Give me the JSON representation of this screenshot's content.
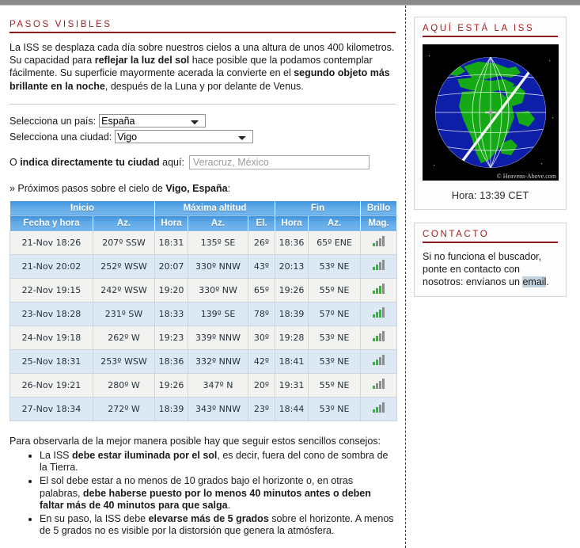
{
  "sections": {
    "visible_passes_title": "PASOS VISIBLES",
    "intro_parts": {
      "p1": "La ISS se desplaza cada día sobre nuestros cielos a una altura de unos 400 kilometros. Su capacidad para ",
      "b1": "reflejar la luz del sol",
      "p2": " hace posible que la podamos contemplar fácilmente. Su superficie mayormente acerada la convierte en el ",
      "b2": "segundo objeto más brillante en la noche",
      "p3": ", después de la Luna y por delante de Venus."
    }
  },
  "form": {
    "country_label": "Selecciona un país:",
    "country_value": "España",
    "city_label": "Selecciona una ciudad:",
    "city_value": "Vigo",
    "direct_pre": "O ",
    "direct_bold": "indica directamente tu ciudad",
    "direct_post": " aquí:",
    "direct_input_value": "",
    "direct_input_placeholder": "Veracruz, México"
  },
  "next_passes": {
    "prefix": "» Próximos pasos sobre el cielo de ",
    "location": "Vigo, España",
    "suffix": ":"
  },
  "table": {
    "group_headers": [
      "Inicio",
      "Máxima altitud",
      "Fin",
      "Brillo"
    ],
    "sub_headers": [
      "Fecha y hora",
      "Az.",
      "Hora",
      "Az.",
      "El.",
      "Hora",
      "Az.",
      "Mag."
    ],
    "rows": [
      {
        "date": "21-Nov 18:26",
        "start_az": "207º SSW",
        "max_time": "18:31",
        "max_az": "135º SE",
        "el": "26º",
        "end_time": "18:36",
        "end_az": "65º ENE",
        "mag_bars": 1
      },
      {
        "date": "21-Nov 20:02",
        "start_az": "252º WSW",
        "max_time": "20:07",
        "max_az": "330º NNW",
        "el": "43º",
        "end_time": "20:13",
        "end_az": "53º NE",
        "mag_bars": 2
      },
      {
        "date": "22-Nov 19:15",
        "start_az": "242º WSW",
        "max_time": "19:20",
        "max_az": "330º NW",
        "el": "65º",
        "end_time": "19:26",
        "end_az": "55º NE",
        "mag_bars": 3
      },
      {
        "date": "23-Nov 18:28",
        "start_az": "231º SW",
        "max_time": "18:33",
        "max_az": "139º SE",
        "el": "78º",
        "end_time": "18:39",
        "end_az": "57º NE",
        "mag_bars": 3
      },
      {
        "date": "24-Nov 19:18",
        "start_az": "262º W",
        "max_time": "19:23",
        "max_az": "339º NNW",
        "el": "30º",
        "end_time": "19:28",
        "end_az": "53º NE",
        "mag_bars": 2
      },
      {
        "date": "25-Nov 18:31",
        "start_az": "253º WSW",
        "max_time": "18:36",
        "max_az": "332º NNW",
        "el": "42º",
        "end_time": "18:41",
        "end_az": "53º NE",
        "mag_bars": 2
      },
      {
        "date": "26-Nov 19:21",
        "start_az": "280º W",
        "max_time": "19:26",
        "max_az": "347º N",
        "el": "20º",
        "end_time": "19:31",
        "end_az": "55º NE",
        "mag_bars": 1
      },
      {
        "date": "27-Nov 18:34",
        "start_az": "272º W",
        "max_time": "18:39",
        "max_az": "343º NNW",
        "el": "23º",
        "end_time": "18:44",
        "end_az": "53º NE",
        "mag_bars": 2
      }
    ]
  },
  "tips": {
    "lead": "Para observarla de la mejor manera posible hay que seguir estos sencillos consejos:",
    "items": [
      {
        "pre": "La ISS ",
        "bold": "debe estar iluminada por el sol",
        "post": ", es decir, fuera del cono de sombra de la Tierra."
      },
      {
        "pre": "El sol debe estar a no menos de 10 grados bajo el horizonte o, en otras palabras, ",
        "bold": "debe haberse puesto por lo menos 40 minutos antes o deben faltar más de 40 minutos para que salga",
        "post": "."
      },
      {
        "pre": "En su paso, la ISS debe ",
        "bold": "elevarse más de 5 grados",
        "post": " sobre el horizonte. A menos de 5 grados no es visible por la distorsión que genera la atmósfera."
      }
    ]
  },
  "sidebar": {
    "iss_panel": {
      "title": "AQUÍ ESTÁ LA ISS",
      "image_credit": "© Heavens-Above.com",
      "time_label": "Hora: 13:39 CET"
    },
    "contact_panel": {
      "title": "CONTACTO",
      "text_pre": "Si no funciona el buscador, ponte en contacto con nosotros: envíanos un ",
      "link_label": "email",
      "text_post": "."
    }
  },
  "colors": {
    "accent_red": "#a32020",
    "rule_red": "#8c1b1b",
    "header_blue": "#5fa8e6",
    "row_odd": "#f2f2f0",
    "row_even": "#dce9f5",
    "bar_green": "#24c124",
    "bar_grey": "#8c8c8c"
  }
}
